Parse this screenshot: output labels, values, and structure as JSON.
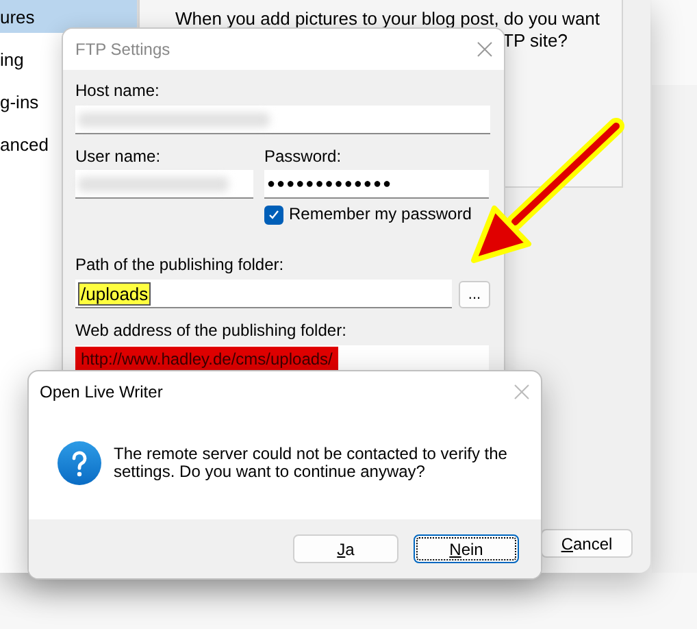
{
  "background_window": {
    "sidebar": {
      "items": [
        {
          "label": "ures",
          "selected": true
        },
        {
          "label": "ing",
          "selected": false
        },
        {
          "label": "g-ins",
          "selected": false
        },
        {
          "label": "anced",
          "selected": false
        }
      ]
    },
    "content": {
      "lines": [
        "When you add pictures to your blog post, do you want",
        "TP site?"
      ]
    },
    "buttons": [
      {
        "label": "Cancel"
      }
    ]
  },
  "ftp_dialog": {
    "title": "FTP Settings",
    "active": false,
    "host": {
      "label": "Host name:"
    },
    "user": {
      "label": "User name:"
    },
    "password": {
      "label": "Password:",
      "value": "●●●●●●●●●●●●●"
    },
    "remember": {
      "label": "Remember my password",
      "checked": true
    },
    "path": {
      "label": "Path of the publishing folder:",
      "value": "/uploads",
      "browse": "..."
    },
    "web_address": {
      "label": "Web address of the publishing folder:",
      "value": "http://www.hadley.de/cms/uploads/"
    }
  },
  "message_box": {
    "title": "Open Live Writer",
    "message": "The remote server could not be contacted to verify the settings. Do you want to continue anyway?",
    "buttons": [
      {
        "label": "Ja",
        "focused": false
      },
      {
        "label": "Nein",
        "focused": true
      }
    ]
  }
}
